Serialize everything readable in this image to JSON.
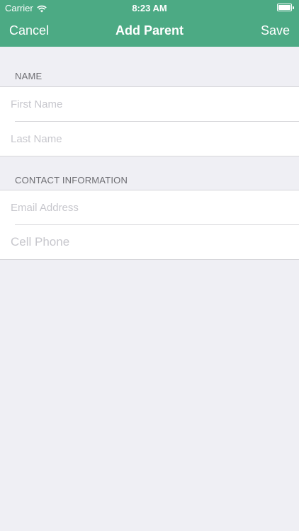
{
  "status_bar": {
    "carrier": "Carrier",
    "time": "8:23 AM",
    "wifi_icon": "wifi-icon",
    "battery_icon": "battery-icon"
  },
  "nav": {
    "cancel_label": "Cancel",
    "title": "Add Parent",
    "save_label": "Save"
  },
  "sections": {
    "name": {
      "header": "NAME",
      "first_name_placeholder": "First Name",
      "last_name_placeholder": "Last Name"
    },
    "contact": {
      "header": "CONTACT INFORMATION",
      "email_placeholder": "Email Address",
      "phone_placeholder": "Cell Phone"
    }
  },
  "colors": {
    "accent": "#4caa84",
    "background": "#efeff4"
  }
}
